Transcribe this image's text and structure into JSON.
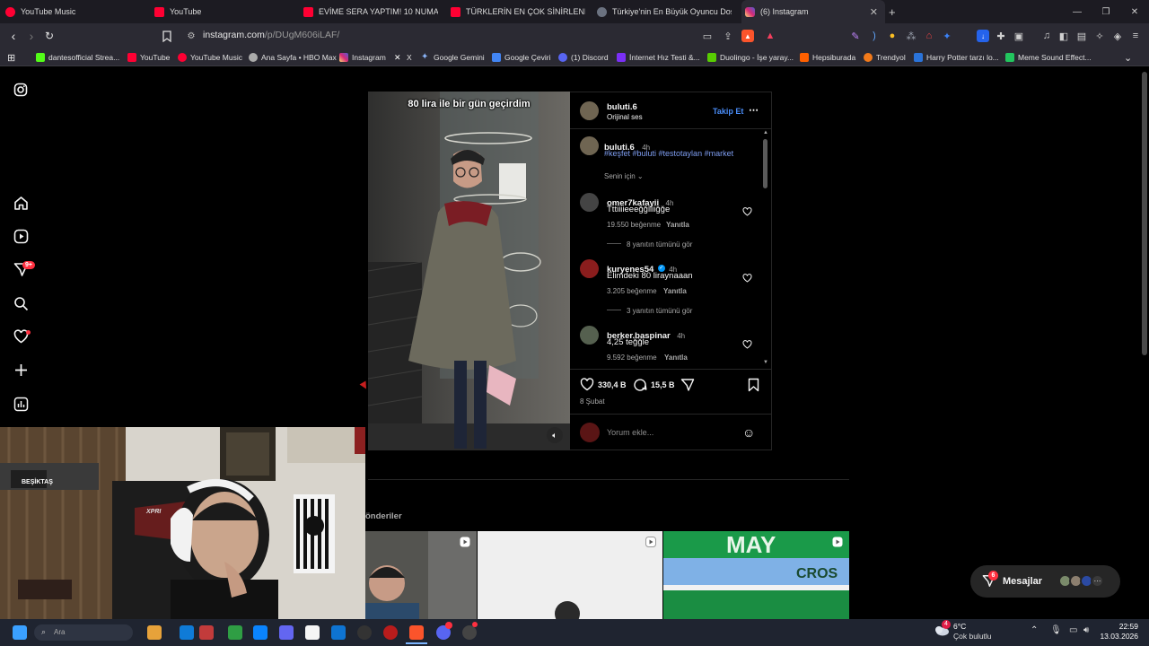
{
  "browser": {
    "tabs": [
      {
        "label": "YouTube Music",
        "color": "#ff0033"
      },
      {
        "label": "YouTube",
        "color": "#ff0033"
      },
      {
        "label": "EVİME SERA YAPTIM! 10 NUMARA O",
        "color": "#ff0033"
      },
      {
        "label": "TÜRKLERİN EN ÇOK SİNİRLENDİĞİ Ş",
        "color": "#ff0033"
      },
      {
        "label": "Türkiye'nin En Büyük Oyuncu Dostu",
        "color": "#3b82f6"
      },
      {
        "label": "(6) Instagram",
        "color": "#dd2a7b"
      }
    ],
    "new_tab": "+",
    "url_main": "instagram.com",
    "url_path": "/p/DUgM606iLAF/",
    "bookmarks": [
      {
        "label": "dantesofficial Strea...",
        "color": "#53fc18"
      },
      {
        "label": "YouTube",
        "color": "#ff0033"
      },
      {
        "label": "YouTube Music",
        "color": "#ff0033"
      },
      {
        "label": "Ana Sayfa • HBO Max",
        "color": "#aaaaaa"
      },
      {
        "label": "Instagram",
        "color": "#dd2a7b"
      },
      {
        "label": "X",
        "color": "#ffffff"
      },
      {
        "label": "Google Gemini",
        "color": "#8ab4f8"
      },
      {
        "label": "Google Çeviri",
        "color": "#4285f4"
      },
      {
        "label": "(1) Discord",
        "color": "#5865f2"
      },
      {
        "label": "İnternet Hız Testi &...",
        "color": "#7b2ff7"
      },
      {
        "label": "Duolingo - İşe yaray...",
        "color": "#58cc02"
      },
      {
        "label": "Hepsiburada",
        "color": "#ff6000"
      },
      {
        "label": "Trendyol",
        "color": "#f27a1a"
      },
      {
        "label": "Harry Potter tarzı lo...",
        "color": "#2a73d9"
      },
      {
        "label": "Meme Sound Effect...",
        "color": "#22c55e"
      }
    ]
  },
  "rail": {
    "notif_badge": "9+"
  },
  "post": {
    "overlay_text": "80 lira ile bir gün geçirdim",
    "author": "buluti.6",
    "audio": "Orijinal ses",
    "follow_label": "Takip Et",
    "caption_user": "buluti.6",
    "caption_time": "4h",
    "caption_tags": "#keşfet #buluti #testotaylan #market",
    "sort_label": "Senin için",
    "comments": [
      {
        "user": "omer7kafayii",
        "time": "4h",
        "text": "Tttiiiieeeğğlliiğğe",
        "likes": "19.550 beğenme",
        "reply": "Yanıtla",
        "more": "8 yanıtın tümünü gör",
        "verified": false
      },
      {
        "user": "kuryenes54",
        "time": "4h",
        "text": "Elimdeki 80 liraynaaan",
        "likes": "3.205 beğenme",
        "reply": "Yanıtla",
        "more": "3 yanıtın tümünü gör",
        "verified": true
      },
      {
        "user": "berker.baspinar",
        "time": "4h",
        "text": "4,25 teğğle",
        "likes": "9.592 beğenme",
        "reply": "Yanıtla",
        "more": "",
        "verified": false
      }
    ],
    "like_count": "330,4 B",
    "comment_count": "15,5 B",
    "date": "8 Şubat",
    "comment_placeholder": "Yorum ekle..."
  },
  "more_section": {
    "label": "önderiler"
  },
  "messages": {
    "label": "Mesajlar",
    "badge": "6"
  },
  "webcam": {
    "jersey_text": "BEŞİKTAŞ",
    "chair_text": "XPRI"
  },
  "taskbar": {
    "weather_temp": "6°C",
    "weather_desc": "Çok bulutlu",
    "weather_badge": "4",
    "time": "22:59",
    "date": "13.03.2026",
    "search_text": "Ara"
  }
}
